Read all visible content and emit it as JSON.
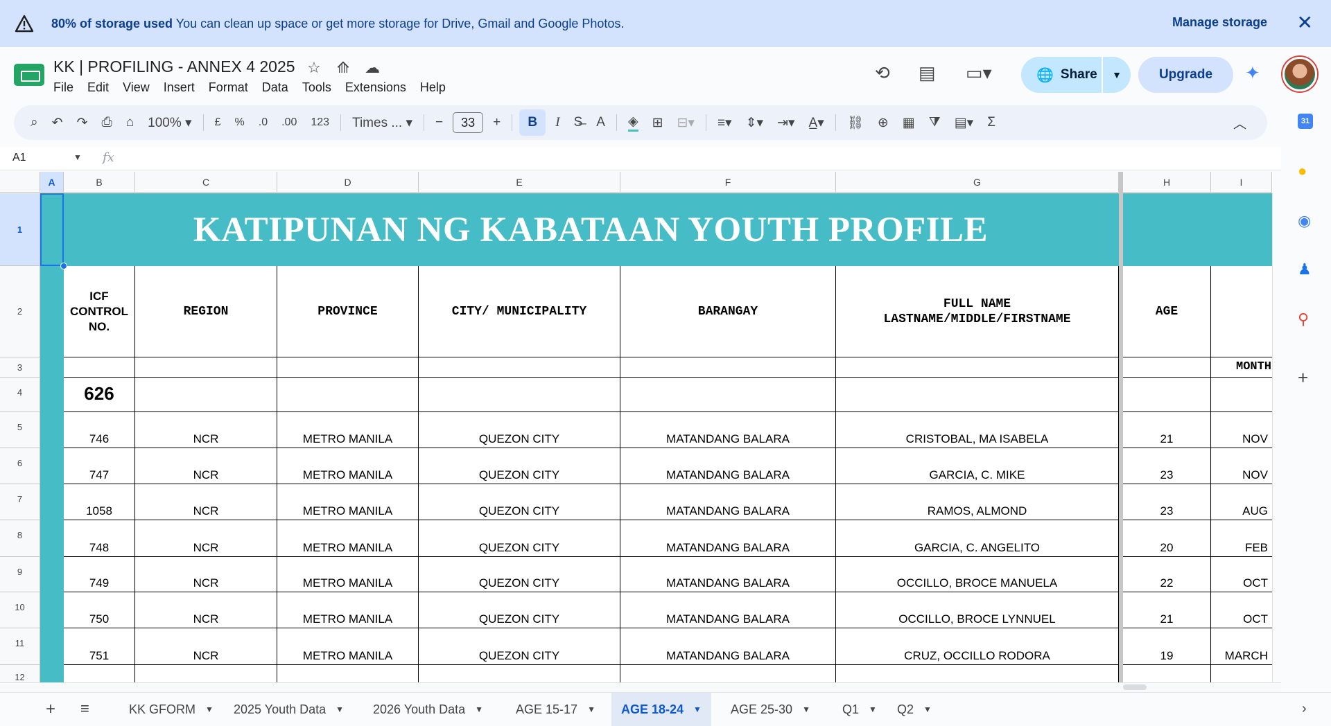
{
  "banner": {
    "bold": "80% of storage used",
    "text": " You can clean up space or get more storage for Drive, Gmail and Google Photos.",
    "manage": "Manage storage",
    "close": "✕"
  },
  "doc": {
    "title": "KK | PROFILING - ANNEX 4 2025",
    "menu": [
      "File",
      "Edit",
      "View",
      "Insert",
      "Format",
      "Data",
      "Tools",
      "Extensions",
      "Help"
    ]
  },
  "actions": {
    "share": "Share",
    "upgrade": "Upgrade"
  },
  "toolbar": {
    "zoom": "100%",
    "currency": "£",
    "percent": "%",
    "dec_less": ".0",
    "dec_more": ".00",
    "format123": "123",
    "font": "Times ...",
    "font_size": "33",
    "bold": "B",
    "italic": "I"
  },
  "formula": {
    "cell_ref": "A1",
    "fx": "fx"
  },
  "columns": [
    "A",
    "B",
    "C",
    "D",
    "E",
    "F",
    "G",
    "H",
    "I"
  ],
  "rows": [
    "1",
    "2",
    "3",
    "4",
    "5",
    "6",
    "7",
    "8",
    "9",
    "10",
    "11",
    "12"
  ],
  "sheet": {
    "title": "KATIPUNAN NG KABATAAN YOUTH PROFILE",
    "headers": {
      "icf": "ICF CONTROL NO.",
      "region": "REGION",
      "province": "PROVINCE",
      "city": "CITY/ MUNICIPALITY",
      "barangay": "BARANGAY",
      "fullname": "FULL NAME LASTNAME/MIDDLE/FIRSTNAME",
      "age": "AGE"
    },
    "row3_i": "MONTH",
    "row4_b": "626",
    "data": [
      {
        "icf": "746",
        "region": "NCR",
        "province": "METRO MANILA",
        "city": "QUEZON CITY",
        "barangay": "MATANDANG BALARA",
        "name": "CRISTOBAL, MA ISABELA",
        "age": "21",
        "month": "NOV"
      },
      {
        "icf": "747",
        "region": "NCR",
        "province": "METRO MANILA",
        "city": "QUEZON CITY",
        "barangay": "MATANDANG BALARA",
        "name": "GARCIA, C. MIKE",
        "age": "23",
        "month": "NOV"
      },
      {
        "icf": "1058",
        "region": "NCR",
        "province": "METRO MANILA",
        "city": "QUEZON CITY",
        "barangay": "MATANDANG BALARA",
        "name": "RAMOS, ALMOND",
        "age": "23",
        "month": "AUG"
      },
      {
        "icf": "748",
        "region": "NCR",
        "province": "METRO MANILA",
        "city": "QUEZON CITY",
        "barangay": "MATANDANG BALARA",
        "name": "GARCIA, C. ANGELITO",
        "age": "20",
        "month": "FEB"
      },
      {
        "icf": "749",
        "region": "NCR",
        "province": "METRO MANILA",
        "city": "QUEZON CITY",
        "barangay": "MATANDANG BALARA",
        "name": "OCCILLO, BROCE MANUELA",
        "age": "22",
        "month": "OCT"
      },
      {
        "icf": "750",
        "region": "NCR",
        "province": "METRO MANILA",
        "city": "QUEZON CITY",
        "barangay": "MATANDANG BALARA",
        "name": "OCCILLO, BROCE LYNNUEL",
        "age": "21",
        "month": "OCT"
      },
      {
        "icf": "751",
        "region": "NCR",
        "province": "METRO MANILA",
        "city": "QUEZON CITY",
        "barangay": "MATANDANG BALARA",
        "name": "CRUZ, OCCILLO RODORA",
        "age": "19",
        "month": "MARCH"
      }
    ]
  },
  "tabs": [
    {
      "label": "KK GFORM",
      "active": false
    },
    {
      "label": "2025 Youth Data",
      "active": false
    },
    {
      "label": "2026 Youth Data",
      "active": false
    },
    {
      "label": "AGE 15-17",
      "active": false
    },
    {
      "label": "AGE 18-24",
      "active": true
    },
    {
      "label": "AGE 25-30",
      "active": false
    },
    {
      "label": "Q1",
      "active": false
    },
    {
      "label": "Q2",
      "active": false
    }
  ],
  "colors": {
    "teal": "#46bdc6",
    "share_bg": "#c2e7ff",
    "banner_bg": "#d3e3fd",
    "active_tab": "#0b57d0"
  },
  "icons": [
    "warning-icon",
    "star-icon",
    "move-icon",
    "cloud-icon",
    "history-icon",
    "comment-icon",
    "meet-icon",
    "globe-icon",
    "gemini-icon",
    "search-icon",
    "undo-icon",
    "redo-icon",
    "print-icon",
    "paint-format-icon"
  ]
}
